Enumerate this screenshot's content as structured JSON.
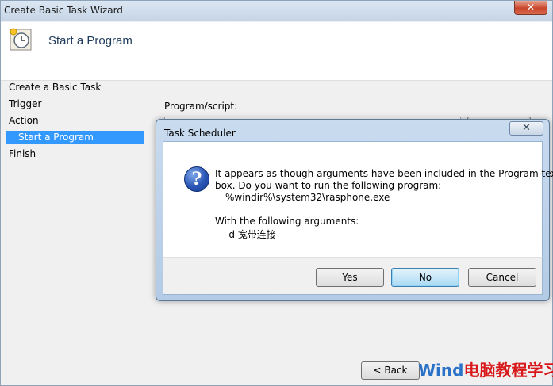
{
  "wizard": {
    "title": "Create Basic Task Wizard",
    "header_title": "Start a Program",
    "steps": [
      "Create a Basic Task",
      "Trigger",
      "Action",
      "Start a Program",
      "Finish"
    ],
    "active_step": "Start a Program",
    "program_label": "Program/script:",
    "back_label": "Back"
  },
  "dialog": {
    "title": "Task Scheduler",
    "message_line1": "It appears as though arguments have been included in the Program text",
    "message_line2": "box. Do you want to run the following program:",
    "program": "%windir%\\system32\\rasphone.exe",
    "arguments_label": "With the following arguments:",
    "arguments": "-d 宽带连接",
    "buttons": {
      "yes": "Yes",
      "no": "No",
      "cancel": "Cancel"
    },
    "close_glyph": "✕"
  },
  "watermark": {
    "part1": "Wind",
    "part2": "电脑教程学习网"
  }
}
